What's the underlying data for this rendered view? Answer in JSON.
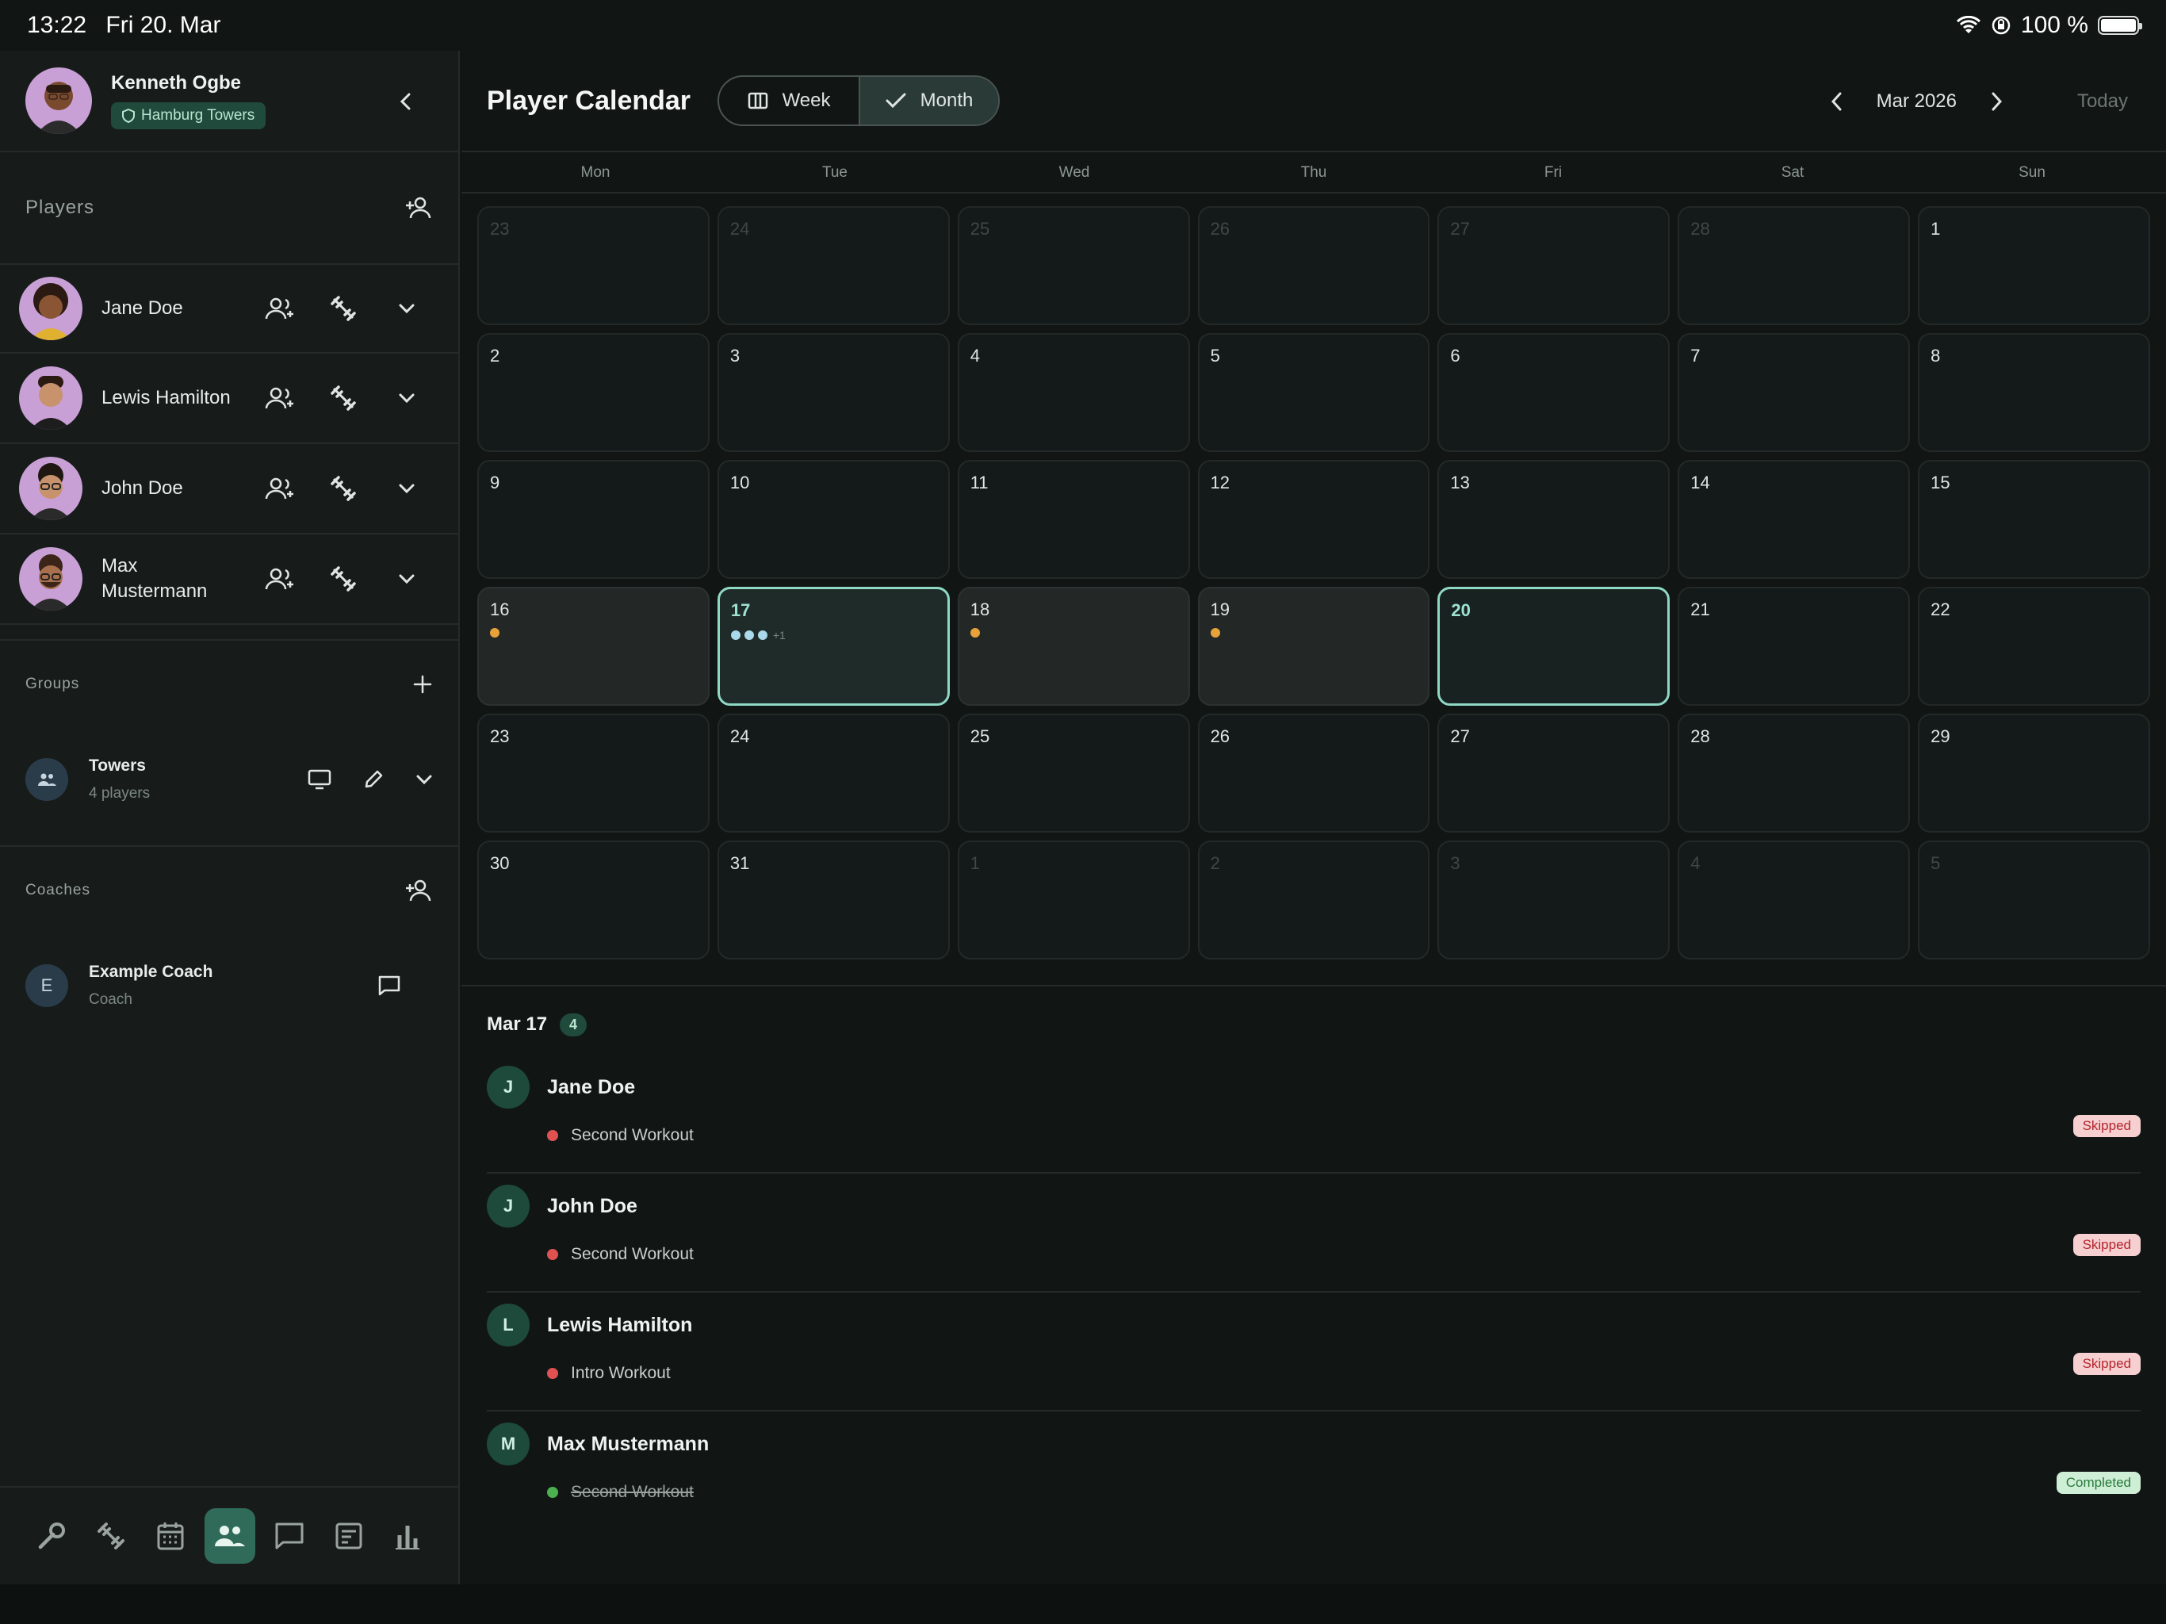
{
  "status_bar": {
    "time": "13:22",
    "date": "Fri 20. Mar",
    "battery": "100 %"
  },
  "profile": {
    "name": "Kenneth Ogbe",
    "team": "Hamburg Towers"
  },
  "players_section": {
    "title": "Players",
    "items": [
      {
        "name": "Jane Doe"
      },
      {
        "name": "Lewis Hamilton"
      },
      {
        "name": "John Doe"
      },
      {
        "name": "Max Mustermann"
      }
    ]
  },
  "groups_section": {
    "title": "Groups",
    "items": [
      {
        "name": "Towers",
        "sub": "4 players"
      }
    ]
  },
  "coaches_section": {
    "title": "Coaches",
    "items": [
      {
        "initial": "E",
        "name": "Example Coach",
        "sub": "Coach"
      }
    ]
  },
  "header": {
    "title": "Player Calendar",
    "week_label": "Week",
    "month_label": "Month",
    "current_month": "Mar 2026",
    "today_label": "Today"
  },
  "weekdays": [
    "Mon",
    "Tue",
    "Wed",
    "Thu",
    "Fri",
    "Sat",
    "Sun"
  ],
  "calendar": {
    "days": [
      {
        "n": "23",
        "muted": true
      },
      {
        "n": "24",
        "muted": true
      },
      {
        "n": "25",
        "muted": true
      },
      {
        "n": "26",
        "muted": true
      },
      {
        "n": "27",
        "muted": true
      },
      {
        "n": "28",
        "muted": true
      },
      {
        "n": "1"
      },
      {
        "n": "2"
      },
      {
        "n": "3"
      },
      {
        "n": "4"
      },
      {
        "n": "5"
      },
      {
        "n": "6"
      },
      {
        "n": "7"
      },
      {
        "n": "8"
      },
      {
        "n": "9"
      },
      {
        "n": "10"
      },
      {
        "n": "11"
      },
      {
        "n": "12"
      },
      {
        "n": "13"
      },
      {
        "n": "14"
      },
      {
        "n": "15"
      },
      {
        "n": "16",
        "events": [
          "#e8a23a"
        ]
      },
      {
        "n": "17",
        "selected": true,
        "events": [
          "#a9d9ea",
          "#a9d9ea",
          "#a9d9ea"
        ],
        "more": "+1"
      },
      {
        "n": "18",
        "events": [
          "#e8a23a"
        ]
      },
      {
        "n": "19",
        "events": [
          "#e8a23a"
        ]
      },
      {
        "n": "20",
        "today": true
      },
      {
        "n": "21"
      },
      {
        "n": "22"
      },
      {
        "n": "23"
      },
      {
        "n": "24"
      },
      {
        "n": "25"
      },
      {
        "n": "26"
      },
      {
        "n": "27"
      },
      {
        "n": "28"
      },
      {
        "n": "29"
      },
      {
        "n": "30"
      },
      {
        "n": "31"
      },
      {
        "n": "1",
        "muted": true
      },
      {
        "n": "2",
        "muted": true
      },
      {
        "n": "3",
        "muted": true
      },
      {
        "n": "4",
        "muted": true
      },
      {
        "n": "5",
        "muted": true
      }
    ]
  },
  "detail": {
    "date": "Mar 17",
    "count": "4",
    "entries": [
      {
        "initial": "J",
        "name": "Jane Doe",
        "workout": "Second Workout",
        "status": "Skipped",
        "status_type": "skipped",
        "dot": "#e05252"
      },
      {
        "initial": "J",
        "name": "John Doe",
        "workout": "Second Workout",
        "status": "Skipped",
        "status_type": "skipped",
        "dot": "#e05252"
      },
      {
        "initial": "L",
        "name": "Lewis Hamilton",
        "workout": "Intro Workout",
        "status": "Skipped",
        "status_type": "skipped",
        "dot": "#e05252"
      },
      {
        "initial": "M",
        "name": "Max Mustermann",
        "workout": "Second Workout",
        "status": "Completed",
        "status_type": "completed",
        "dot": "#4caf50"
      }
    ]
  },
  "bottom_nav": [
    {
      "icon": "wrench-icon"
    },
    {
      "icon": "dumbbell-icon"
    },
    {
      "icon": "calendar-icon"
    },
    {
      "icon": "people-icon",
      "active": true
    },
    {
      "icon": "chat-icon"
    },
    {
      "icon": "notes-icon"
    },
    {
      "icon": "bar-chart-icon"
    }
  ]
}
